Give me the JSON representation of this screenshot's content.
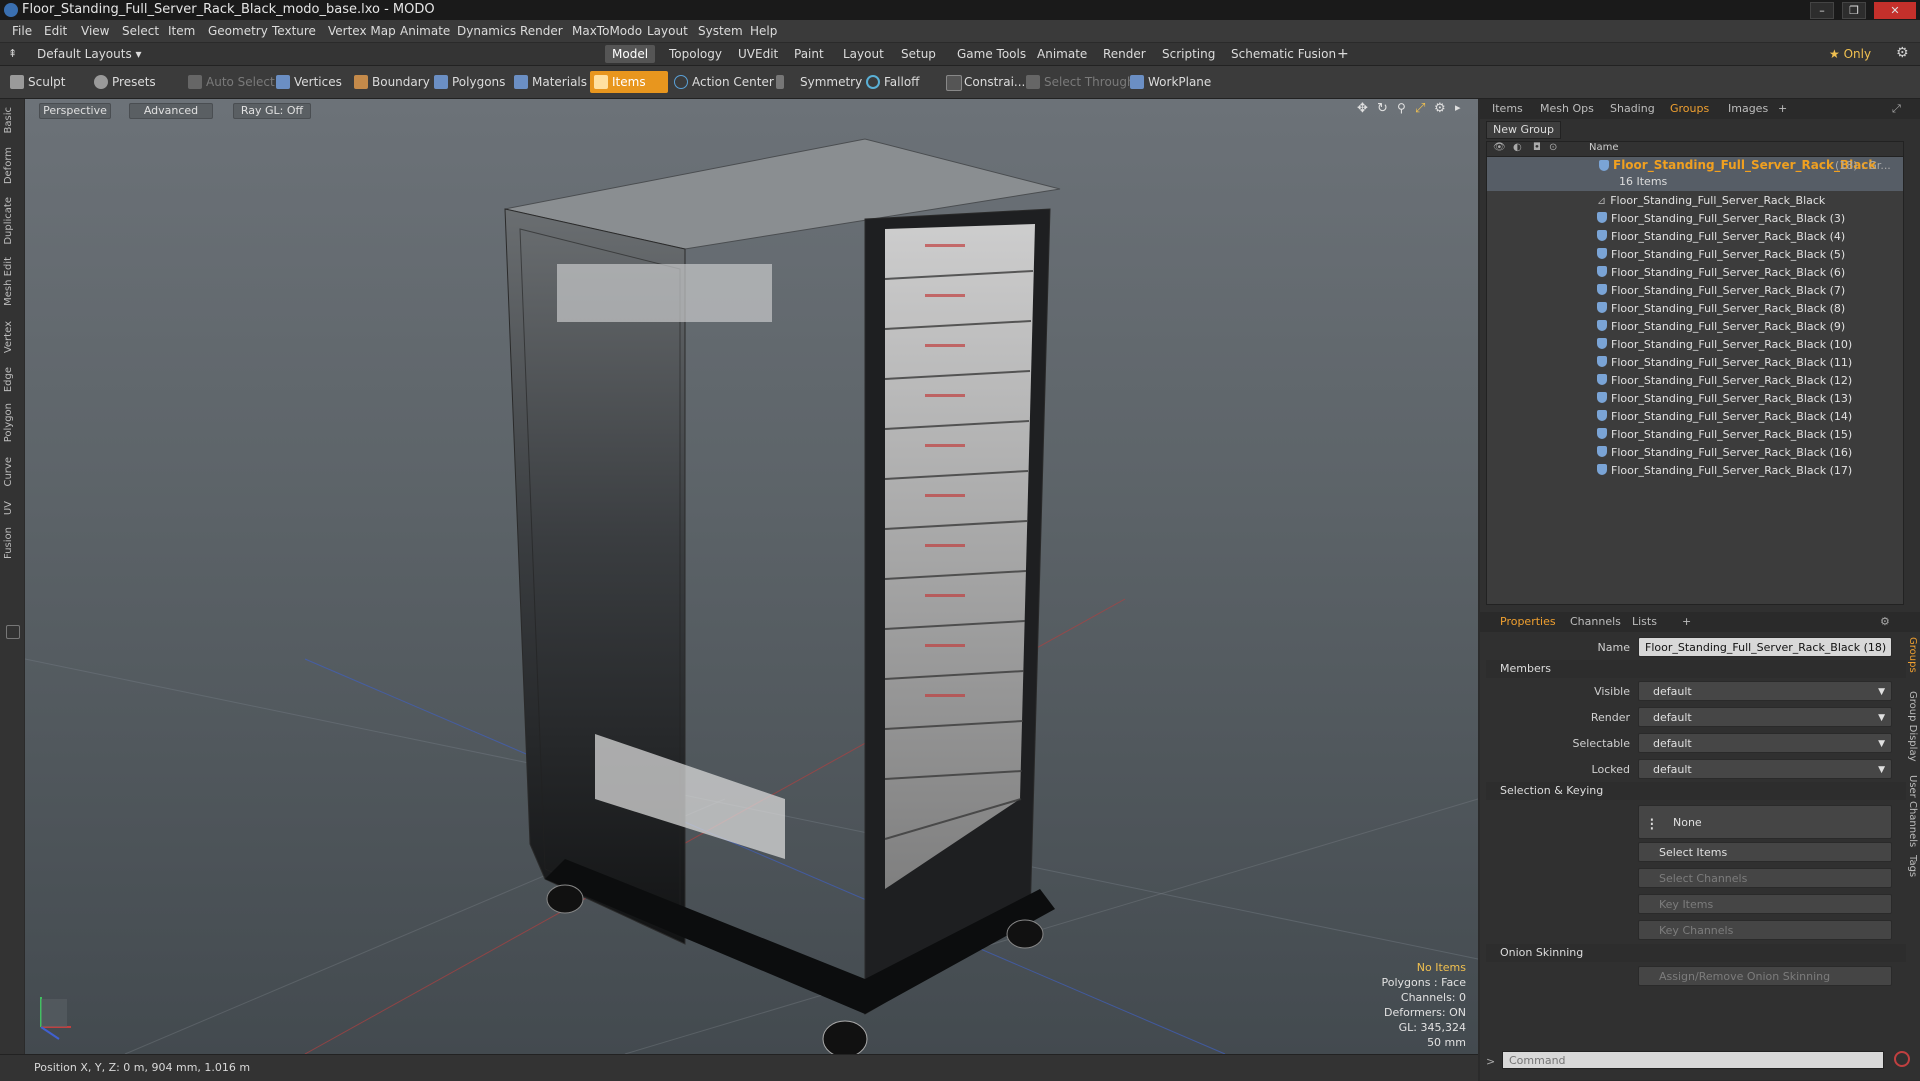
{
  "window": {
    "title": "Floor_Standing_Full_Server_Rack_Black_modo_base.lxo - MODO",
    "min": "–",
    "max": "❐",
    "close": "✕"
  },
  "menubar": [
    "File",
    "Edit",
    "View",
    "Select",
    "Item",
    "Geometry",
    "Texture",
    "Vertex Map",
    "Animate",
    "Dynamics",
    "Render",
    "MaxToModo",
    "Layout",
    "System",
    "Help"
  ],
  "layoutbar": {
    "layouts_label": "Default Layouts ▾",
    "tabs": [
      "Model",
      "Topology",
      "UVEdit",
      "Paint",
      "Layout",
      "Setup",
      "Game Tools",
      "Animate",
      "Render",
      "Scripting",
      "Schematic Fusion"
    ],
    "active_tab": "Model",
    "add": "+",
    "only": "★  Only"
  },
  "toolbar": [
    {
      "label": "Sculpt",
      "icon": "sculpt-icon",
      "color": "#9a9a9a",
      "state": "normal"
    },
    {
      "label": "Presets",
      "icon": "presets-icon",
      "color": "#9a9a9a",
      "state": "normal"
    },
    {
      "label": "Auto Select",
      "icon": "auto-select-icon",
      "color": "#777777",
      "state": "disabled"
    },
    {
      "label": "Vertices",
      "icon": "vertices-icon",
      "color": "#6b8fc4",
      "state": "normal"
    },
    {
      "label": "Boundary",
      "icon": "boundary-icon",
      "color": "#c48a4a",
      "state": "normal"
    },
    {
      "label": "Polygons",
      "icon": "polygons-icon",
      "color": "#6b8fc4",
      "state": "normal"
    },
    {
      "label": "Materials",
      "icon": "materials-icon",
      "color": "#6b8fc4",
      "state": "normal"
    },
    {
      "label": "Items",
      "icon": "items-icon",
      "color": "#ffffff",
      "state": "active"
    },
    {
      "label": "Action Center",
      "icon": "action-center-icon",
      "color": "#5aa0d6",
      "state": "normal"
    },
    {
      "label": "Symmetry",
      "icon": "symmetry-icon",
      "color": "#888888",
      "state": "normal"
    },
    {
      "label": "Falloff",
      "icon": "falloff-icon",
      "color": "#5ab0d6",
      "state": "normal"
    },
    {
      "label": "Constrai...",
      "icon": "constraint-icon",
      "color": "#888888",
      "state": "normal"
    },
    {
      "label": "Select Through",
      "icon": "select-through-icon",
      "color": "#777777",
      "state": "disabled"
    },
    {
      "label": "WorkPlane",
      "icon": "workplane-icon",
      "color": "#6b8fc4",
      "state": "normal"
    }
  ],
  "left_tabs": [
    "Basic",
    "Deform",
    "Duplicate",
    "Mesh Edit",
    "Vertex",
    "Edge",
    "Polygon",
    "Curve",
    "UV",
    "Fusion"
  ],
  "viewport": {
    "buttons": [
      "Perspective",
      "Advanced",
      "Ray GL: Off"
    ],
    "info": {
      "items": "No Items",
      "polygons": "Polygons : Face",
      "channels": "Channels: 0",
      "deformers": "Deformers: ON",
      "gl": "GL: 345,324",
      "size": "50 mm"
    }
  },
  "status": {
    "position": "Position X, Y, Z:  0 m, 904 mm, 1.016 m"
  },
  "top_panel": {
    "tabs": [
      "Items",
      "Mesh Ops",
      "Shading",
      "Groups",
      "Images",
      "+"
    ],
    "active_tab": "Groups",
    "new_group": "New Group",
    "column_name": "Name",
    "group_name": "Floor_Standing_Full_Server_Rack_Black",
    "group_suffix": "(18) : Gr...",
    "group_count": "16 Items",
    "items": [
      "Floor_Standing_Full_Server_Rack_Black",
      "Floor_Standing_Full_Server_Rack_Black (3)",
      "Floor_Standing_Full_Server_Rack_Black (4)",
      "Floor_Standing_Full_Server_Rack_Black (5)",
      "Floor_Standing_Full_Server_Rack_Black (6)",
      "Floor_Standing_Full_Server_Rack_Black (7)",
      "Floor_Standing_Full_Server_Rack_Black (8)",
      "Floor_Standing_Full_Server_Rack_Black (9)",
      "Floor_Standing_Full_Server_Rack_Black (10)",
      "Floor_Standing_Full_Server_Rack_Black (11)",
      "Floor_Standing_Full_Server_Rack_Black (12)",
      "Floor_Standing_Full_Server_Rack_Black (13)",
      "Floor_Standing_Full_Server_Rack_Black (14)",
      "Floor_Standing_Full_Server_Rack_Black (15)",
      "Floor_Standing_Full_Server_Rack_Black (16)",
      "Floor_Standing_Full_Server_Rack_Black (17)"
    ]
  },
  "properties": {
    "tabs": [
      "Properties",
      "Channels",
      "Lists",
      "+"
    ],
    "active_tab": "Properties",
    "name_label": "Name",
    "name_value": "Floor_Standing_Full_Server_Rack_Black (18)",
    "members_section": "Members",
    "visible_label": "Visible",
    "visible_value": "default",
    "render_label": "Render",
    "render_value": "default",
    "selectable_label": "Selectable",
    "selectable_value": "default",
    "locked_label": "Locked",
    "locked_value": "default",
    "selection_section": "Selection & Keying",
    "none_btn": "None",
    "select_items": "Select Items",
    "select_channels": "Select Channels",
    "key_items": "Key Items",
    "key_channels": "Key Channels",
    "onion_section": "Onion Skinning",
    "assign_onion": "Assign/Remove Onion Skinning",
    "side_tabs": [
      "Groups",
      "Group Display",
      "User Channels",
      "Tags"
    ]
  },
  "command": {
    "placeholder": "Command"
  },
  "colors": {
    "accent": "#e8961e",
    "active_text": "#f0a030",
    "group_highlight": "#f0a020"
  }
}
